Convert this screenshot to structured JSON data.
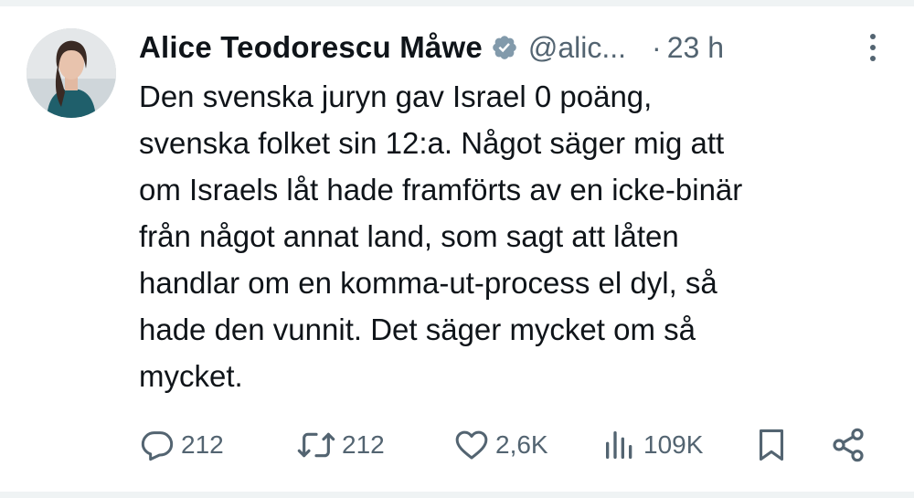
{
  "tweet": {
    "author_name": "Alice Teodorescu Måwe",
    "handle": "@alic...",
    "separator": "·",
    "timestamp": "23 h",
    "text_lines": [
      "Den svenska juryn gav Israel 0 poäng,",
      "svenska folket sin 12:a. Något säger mig att",
      "om Israels låt hade framförts av en icke-binär",
      "från något annat land, som sagt att låten",
      "handlar om en komma-ut-process el dyl, så",
      "hade den vunnit. Det säger mycket om så",
      "mycket."
    ]
  },
  "actions": {
    "replies": "212",
    "reposts": "212",
    "likes": "2,6K",
    "views": "109K"
  },
  "icons": {
    "verified": "verified-badge-icon",
    "more": "more-vertical-icon",
    "reply": "reply-icon",
    "repost": "repost-icon",
    "like": "heart-icon",
    "views": "views-icon",
    "bookmark": "bookmark-icon",
    "share": "share-icon"
  },
  "colors": {
    "text": "#0f1419",
    "secondary": "#536471",
    "verified_badge": "#829aab",
    "divider": "#eff3f4"
  }
}
